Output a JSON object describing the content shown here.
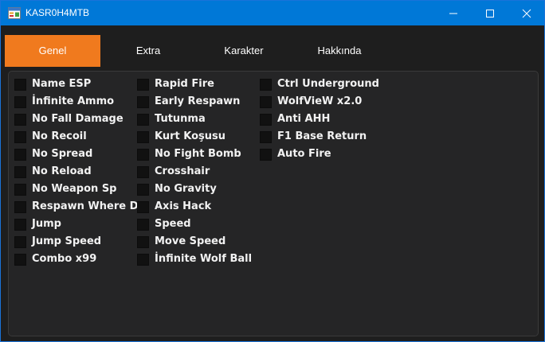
{
  "window": {
    "title": "KASR0H4MTB",
    "app_icon": "app-form-icon"
  },
  "titlebar_controls": [
    "minimize-icon",
    "maximize-icon",
    "close-icon"
  ],
  "tabs": [
    {
      "label": "Genel",
      "active": true
    },
    {
      "label": "Extra",
      "active": false
    },
    {
      "label": "Karakter",
      "active": false
    },
    {
      "label": "Hakkında",
      "active": false
    }
  ],
  "options": {
    "col1": [
      "Name ESP",
      "İnfinite Ammo",
      "No Fall Damage",
      "No Recoil",
      "No Spread",
      "No Reload",
      "No Weapon Sp",
      "Respawn Where Died",
      "Jump",
      "Jump Speed",
      "Combo x99"
    ],
    "col2": [
      "Rapid Fire",
      "Early Respawn",
      "Tutunma",
      "Kurt Koşusu",
      "No Fight Bomb",
      "Crosshair",
      "No Gravity",
      "Axis Hack",
      "Speed",
      "Move Speed",
      "İnfinite Wolf Ball"
    ],
    "col3": [
      "Ctrl Underground",
      "WolfVieW x2.0",
      "Anti AHH",
      "F1 Base Return",
      "Auto Fire"
    ]
  },
  "colors": {
    "titlebar": "#0078d7",
    "accent_tab": "#f07a1e",
    "background": "#1e1e1e",
    "panel": "#252526",
    "text": "#f2f2f2"
  }
}
